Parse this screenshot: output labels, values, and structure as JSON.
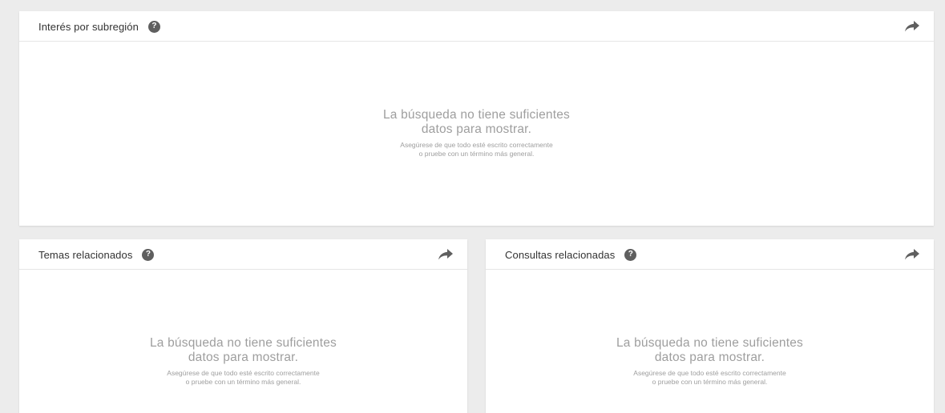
{
  "cards": {
    "subregion": {
      "title": "Interés por subregión",
      "empty_line1": "La búsqueda no tiene suficientes",
      "empty_line2": "datos para mostrar.",
      "hint_line1": "Asegúrese de que todo esté escrito correctamente",
      "hint_line2": "o pruebe con un término más general."
    },
    "topics": {
      "title": "Temas relacionados",
      "empty_line1": "La búsqueda no tiene suficientes",
      "empty_line2": "datos para mostrar.",
      "hint_line1": "Asegúrese de que todo esté escrito correctamente",
      "hint_line2": "o pruebe con un término más general."
    },
    "queries": {
      "title": "Consultas relacionadas",
      "empty_line1": "La búsqueda no tiene suficientes",
      "empty_line2": "datos para mostrar.",
      "hint_line1": "Asegúrese de que todo esté escrito correctamente",
      "hint_line2": "o pruebe con un término más general."
    }
  },
  "icons": {
    "help": "help-icon",
    "help_glyph": "?",
    "share": "share-icon"
  },
  "colors": {
    "background": "#ececec",
    "card": "#ffffff",
    "muted_text": "#9e9e9e",
    "icon": "#5f5f5f"
  }
}
